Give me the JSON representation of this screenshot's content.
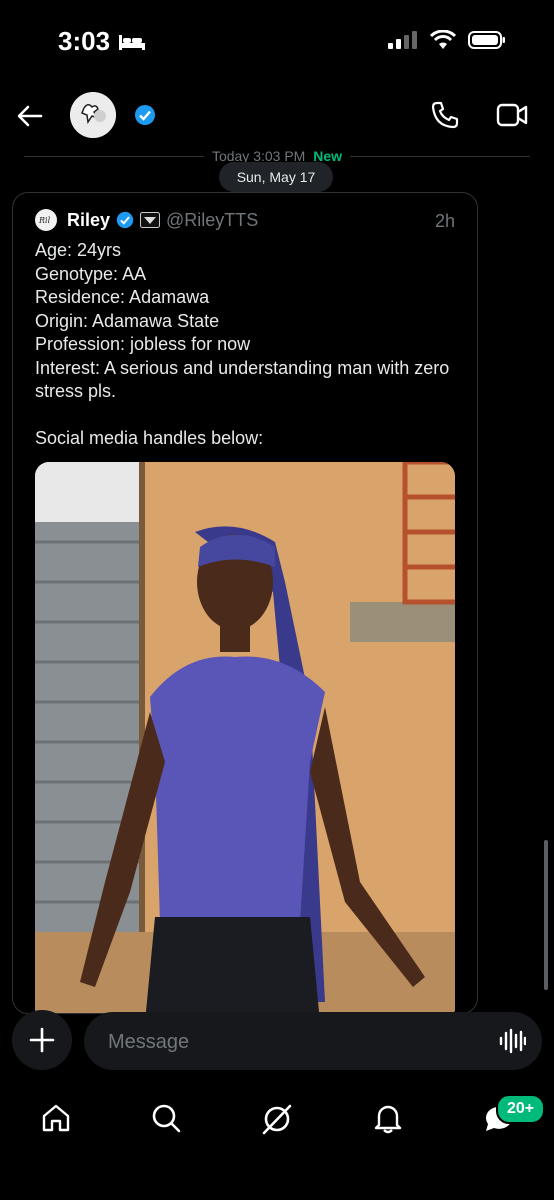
{
  "status": {
    "time": "3:03"
  },
  "header": {
    "verified": true
  },
  "conversation": {
    "today_label": "Today 3:03 PM",
    "new_label": "New",
    "date_label": "Sun, May 17"
  },
  "tweet": {
    "name": "Riley",
    "handle": "@RileyTTS",
    "age": "2h",
    "lines": [
      "Age: 24yrs",
      "Genotype: AA",
      "Residence: Adamawa",
      "Origin: Adamawa State",
      "Profession: jobless for now",
      "Interest: A serious and understanding man with zero stress pls.",
      "",
      "Social media handles below:"
    ]
  },
  "composer": {
    "placeholder": "Message"
  },
  "nav": {
    "badge": "20+"
  },
  "colors": {
    "accent": "#1d9bf0",
    "new": "#00ba7c",
    "background": "#000000"
  }
}
